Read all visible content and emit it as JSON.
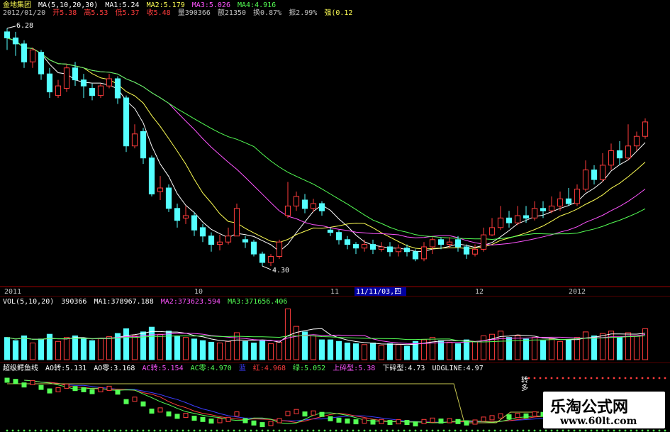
{
  "price_header": {
    "name": "金地集团",
    "ma_label": "MA(5,10,20,30)",
    "ma1": "MA1:5.24",
    "ma2": "MA2:5.179",
    "ma3": "MA3:5.026",
    "ma4": "MA4:4.916",
    "date": "2012/01/20",
    "open": "开5.38",
    "high": "高5.53",
    "low": "低5.37",
    "close": "收5.48",
    "volume": "量390366",
    "amount": "额21350",
    "turnover": "换0.87%",
    "amplitude": "振2.99%",
    "strength": "强(0.12"
  },
  "price_labels": {
    "high_mark": "6.28",
    "low_mark": "4.30"
  },
  "time_axis": {
    "labels": [
      "2011",
      "10",
      "11",
      "11/11/03,四",
      "12",
      "2012"
    ]
  },
  "vol_header": {
    "label": "VOL(5,10,20)",
    "value": "390366",
    "ma1": "MA1:378967.188",
    "ma2": "MA2:373623.594",
    "ma3": "MA3:371656.406"
  },
  "ind_header": {
    "name": "超级鳄鱼线",
    "ao_zhuan": "AO转:5.131",
    "ao_ling": "AO零:3.168",
    "ac_zhuan": "AC转:5.154",
    "ac_ling": "AC零:4.970",
    "lan": "蓝",
    "hong": "红:4.968",
    "lv": "绿:5.052",
    "shang": "上碎型:5.38",
    "xia": "下碎型:4.73",
    "udg": "UDGLINE:4.97",
    "zhuanduo": "转多"
  },
  "watermark": {
    "title": "乐淘公式网",
    "url": "www.60lt.com"
  },
  "colors": {
    "up": "#ff3c3c",
    "down": "#54ffff",
    "ma1": "#ffffff",
    "ma2": "#ffff54",
    "ma3": "#ff54ff",
    "ma4": "#54ff54",
    "bg": "#000000"
  },
  "chart_data": [
    {
      "type": "candlestick",
      "title": "金地集团",
      "ylim": [
        4.2,
        6.35
      ],
      "series": [
        {
          "name": "K",
          "ohlc": [
            [
              6.25,
              6.2,
              6.28,
              6.1
            ],
            [
              6.2,
              6.15,
              6.25,
              6.05
            ],
            [
              6.15,
              6.0,
              6.18,
              5.95
            ],
            [
              6.0,
              6.1,
              6.12,
              5.95
            ],
            [
              6.08,
              5.9,
              6.1,
              5.85
            ],
            [
              5.9,
              5.75,
              5.95,
              5.7
            ],
            [
              5.72,
              5.8,
              5.85,
              5.7
            ],
            [
              5.78,
              5.95,
              5.98,
              5.75
            ],
            [
              5.95,
              5.85,
              6.0,
              5.8
            ],
            [
              5.85,
              5.8,
              5.9,
              5.7
            ],
            [
              5.78,
              5.72,
              5.82,
              5.68
            ],
            [
              5.72,
              5.8,
              5.82,
              5.7
            ],
            [
              5.8,
              5.86,
              5.9,
              5.78
            ],
            [
              5.86,
              5.7,
              5.88,
              5.65
            ],
            [
              5.7,
              5.3,
              5.72,
              5.25
            ],
            [
              5.3,
              5.4,
              5.48,
              5.28
            ],
            [
              5.42,
              5.2,
              5.45,
              5.15
            ],
            [
              5.2,
              4.9,
              5.22,
              4.88
            ],
            [
              4.92,
              4.95,
              5.05,
              4.85
            ],
            [
              4.95,
              4.78,
              4.98,
              4.75
            ],
            [
              4.78,
              4.68,
              4.82,
              4.62
            ],
            [
              4.7,
              4.72,
              4.8,
              4.65
            ],
            [
              4.72,
              4.6,
              4.75,
              4.55
            ],
            [
              4.62,
              4.55,
              4.65,
              4.5
            ],
            [
              4.55,
              4.48,
              4.58,
              4.42
            ],
            [
              4.48,
              4.5,
              4.56,
              4.43
            ],
            [
              4.5,
              4.55,
              4.62,
              4.48
            ],
            [
              4.55,
              4.78,
              4.82,
              4.55
            ],
            [
              4.52,
              4.5,
              4.55,
              4.45
            ],
            [
              4.5,
              4.4,
              4.52,
              4.38
            ],
            [
              4.4,
              4.33,
              4.42,
              4.3
            ],
            [
              4.33,
              4.38,
              4.4,
              4.3
            ],
            [
              4.38,
              4.5,
              4.52,
              4.36
            ],
            [
              4.72,
              4.8,
              5.0,
              4.7
            ],
            [
              4.8,
              4.88,
              4.92,
              4.76
            ],
            [
              4.85,
              4.78,
              4.9,
              4.74
            ],
            [
              4.78,
              4.82,
              4.86,
              4.75
            ],
            [
              4.82,
              4.76,
              4.84,
              4.72
            ],
            [
              4.6,
              4.58,
              4.62,
              4.55
            ],
            [
              4.58,
              4.52,
              4.6,
              4.48
            ],
            [
              4.52,
              4.48,
              4.55,
              4.44
            ],
            [
              4.48,
              4.45,
              4.5,
              4.4
            ],
            [
              4.45,
              4.48,
              4.52,
              4.42
            ],
            [
              4.48,
              4.44,
              4.52,
              4.4
            ],
            [
              4.44,
              4.46,
              4.5,
              4.42
            ],
            [
              4.46,
              4.42,
              4.5,
              4.38
            ],
            [
              4.42,
              4.45,
              4.48,
              4.38
            ],
            [
              4.45,
              4.42,
              4.48,
              4.38
            ],
            [
              4.42,
              4.36,
              4.44,
              4.34
            ],
            [
              4.36,
              4.46,
              4.5,
              4.34
            ],
            [
              4.46,
              4.52,
              4.54,
              4.4
            ],
            [
              4.52,
              4.48,
              4.54,
              4.44
            ],
            [
              4.48,
              4.5,
              4.54,
              4.45
            ],
            [
              4.52,
              4.46,
              4.55,
              4.42
            ],
            [
              4.46,
              4.4,
              4.48,
              4.36
            ],
            [
              4.4,
              4.44,
              4.48,
              4.38
            ],
            [
              4.44,
              4.56,
              4.62,
              4.42
            ],
            [
              4.56,
              4.62,
              4.7,
              4.55
            ],
            [
              4.62,
              4.7,
              4.8,
              4.6
            ],
            [
              4.7,
              4.66,
              4.76,
              4.62
            ],
            [
              4.66,
              4.72,
              4.8,
              4.64
            ],
            [
              4.72,
              4.7,
              4.8,
              4.66
            ],
            [
              4.7,
              4.78,
              4.84,
              4.68
            ],
            [
              4.78,
              4.76,
              4.84,
              4.7
            ],
            [
              4.76,
              4.8,
              4.88,
              4.74
            ],
            [
              4.8,
              4.86,
              4.92,
              4.76
            ],
            [
              4.86,
              4.82,
              4.95,
              4.8
            ],
            [
              4.82,
              4.94,
              4.98,
              4.8
            ],
            [
              4.94,
              5.1,
              5.18,
              4.92
            ],
            [
              5.1,
              5.02,
              5.14,
              4.98
            ],
            [
              5.02,
              5.14,
              5.24,
              5.0
            ],
            [
              5.14,
              5.26,
              5.32,
              5.1
            ],
            [
              5.26,
              5.2,
              5.34,
              5.14
            ],
            [
              5.2,
              5.3,
              5.48,
              5.18
            ],
            [
              5.3,
              5.38,
              5.42,
              5.26
            ],
            [
              5.38,
              5.5,
              5.53,
              5.36
            ]
          ]
        }
      ]
    },
    {
      "type": "bar",
      "title": "VOL(5,10,20)",
      "ylim": [
        0,
        680000
      ],
      "series": [
        {
          "name": "VOL",
          "values": [
            280000,
            240000,
            300000,
            210000,
            260000,
            320000,
            230000,
            280000,
            300000,
            260000,
            240000,
            270000,
            290000,
            330000,
            390000,
            300000,
            350000,
            410000,
            320000,
            360000,
            300000,
            280000,
            260000,
            240000,
            220000,
            210000,
            230000,
            340000,
            230000,
            210000,
            240000,
            200000,
            220000,
            640000,
            420000,
            350000,
            300000,
            250000,
            250000,
            230000,
            210000,
            200000,
            190000,
            210000,
            180000,
            200000,
            190000,
            170000,
            230000,
            250000,
            280000,
            240000,
            220000,
            200000,
            250000,
            230000,
            300000,
            320000,
            360000,
            280000,
            300000,
            260000,
            280000,
            240000,
            260000,
            230000,
            250000,
            280000,
            350000,
            300000,
            330000,
            360000,
            280000,
            340000,
            300000,
            390366
          ]
        }
      ]
    }
  ]
}
